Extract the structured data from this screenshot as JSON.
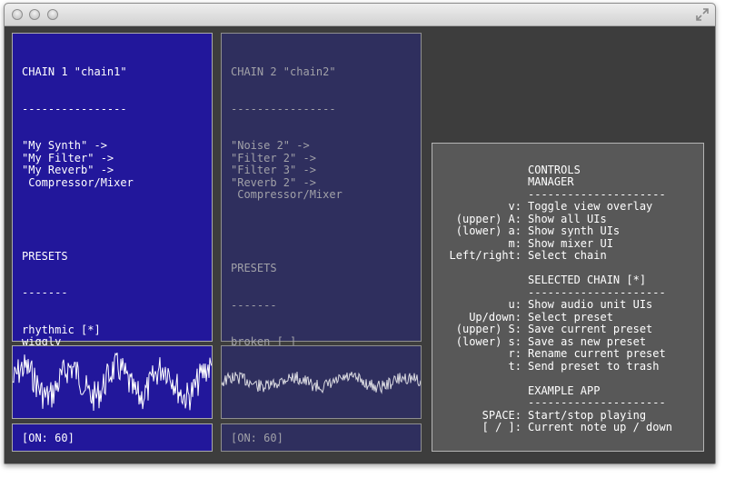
{
  "window": {
    "buttons": [
      "close",
      "minimize",
      "zoom"
    ],
    "fullscreen_icon": "expand-arrows-icon"
  },
  "chain1": {
    "title": "CHAIN 1 \"chain1\"",
    "underline": "----------------",
    "units": [
      "\"My Synth\" ->",
      "\"My Filter\" ->",
      "\"My Reverb\" ->",
      " Compressor/Mixer"
    ],
    "presets_heading": "PRESETS",
    "presets_underline": "-------",
    "presets": [
      "rhythmic [*]",
      "wiggly"
    ],
    "status": "[ON: 60]",
    "colors": {
      "background": "#22179b",
      "text": "#ffffff"
    }
  },
  "chain2": {
    "title": "CHAIN 2 \"chain2\"",
    "underline": "----------------",
    "units": [
      "\"Noise 2\" ->",
      "\"Filter 2\" ->",
      "\"Filter 3\" ->",
      "\"Reverb 2\" ->",
      " Compressor/Mixer"
    ],
    "presets_heading": "PRESETS",
    "presets_underline": "-------",
    "presets": [
      "broken [ ]"
    ],
    "status": "[ON: 60]",
    "colors": {
      "background": "#2f2f5e",
      "text": "#a1a1a8"
    }
  },
  "controls": {
    "title": "CONTROLS",
    "sections": [
      {
        "heading": "MANAGER",
        "underline": "---------------------",
        "items": [
          {
            "key": "v:",
            "action": "Toggle view overlay"
          },
          {
            "key": "(upper) A:",
            "action": "Show all UIs"
          },
          {
            "key": "(lower) a:",
            "action": "Show synth UIs"
          },
          {
            "key": "m:",
            "action": "Show mixer UI"
          },
          {
            "key": "Left/right:",
            "action": "Select chain"
          }
        ]
      },
      {
        "heading": "SELECTED CHAIN [*]",
        "underline": "---------------------",
        "items": [
          {
            "key": "u:",
            "action": "Show audio unit UIs"
          },
          {
            "key": "Up/down:",
            "action": "Select preset"
          },
          {
            "key": "(upper) S:",
            "action": "Save current preset"
          },
          {
            "key": "(lower) s:",
            "action": "Save as new preset"
          },
          {
            "key": "r:",
            "action": "Rename current preset"
          },
          {
            "key": "t:",
            "action": "Send preset to trash"
          }
        ]
      },
      {
        "heading": "EXAMPLE APP",
        "underline": "---------------------",
        "items": [
          {
            "key": "SPACE:",
            "action": "Start/stop playing"
          },
          {
            "key": "[ / ]:",
            "action": "Current note up / down"
          }
        ]
      }
    ]
  }
}
